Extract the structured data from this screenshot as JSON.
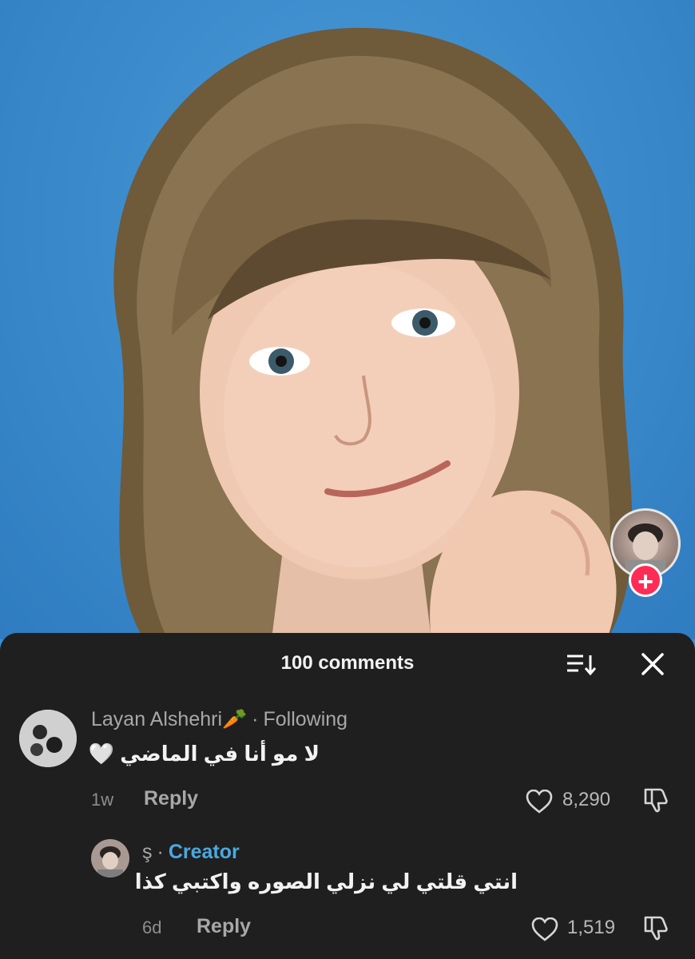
{
  "video": {
    "creator_follow_label": "+"
  },
  "comments_sheet": {
    "title": "100 comments",
    "comments": [
      {
        "username": "Layan Alshehri🥕",
        "separator": "·",
        "relation": "Following",
        "text": "لا مو أنا في الماضي 🤍",
        "age": "1w",
        "reply_label": "Reply",
        "likes": "8,290"
      },
      {
        "username": "ş",
        "separator": "·",
        "relation": "Creator",
        "text": "انتي قلتي لي نزلي الصوره واكتبي كذا",
        "age": "6d",
        "reply_label": "Reply",
        "likes": "1,519"
      }
    ]
  },
  "colors": {
    "video_background": "#3d8fd0",
    "sheet_background": "#1f1f1f",
    "creator_badge": "#4aa9e0",
    "follow_button": "#fe2c55"
  }
}
